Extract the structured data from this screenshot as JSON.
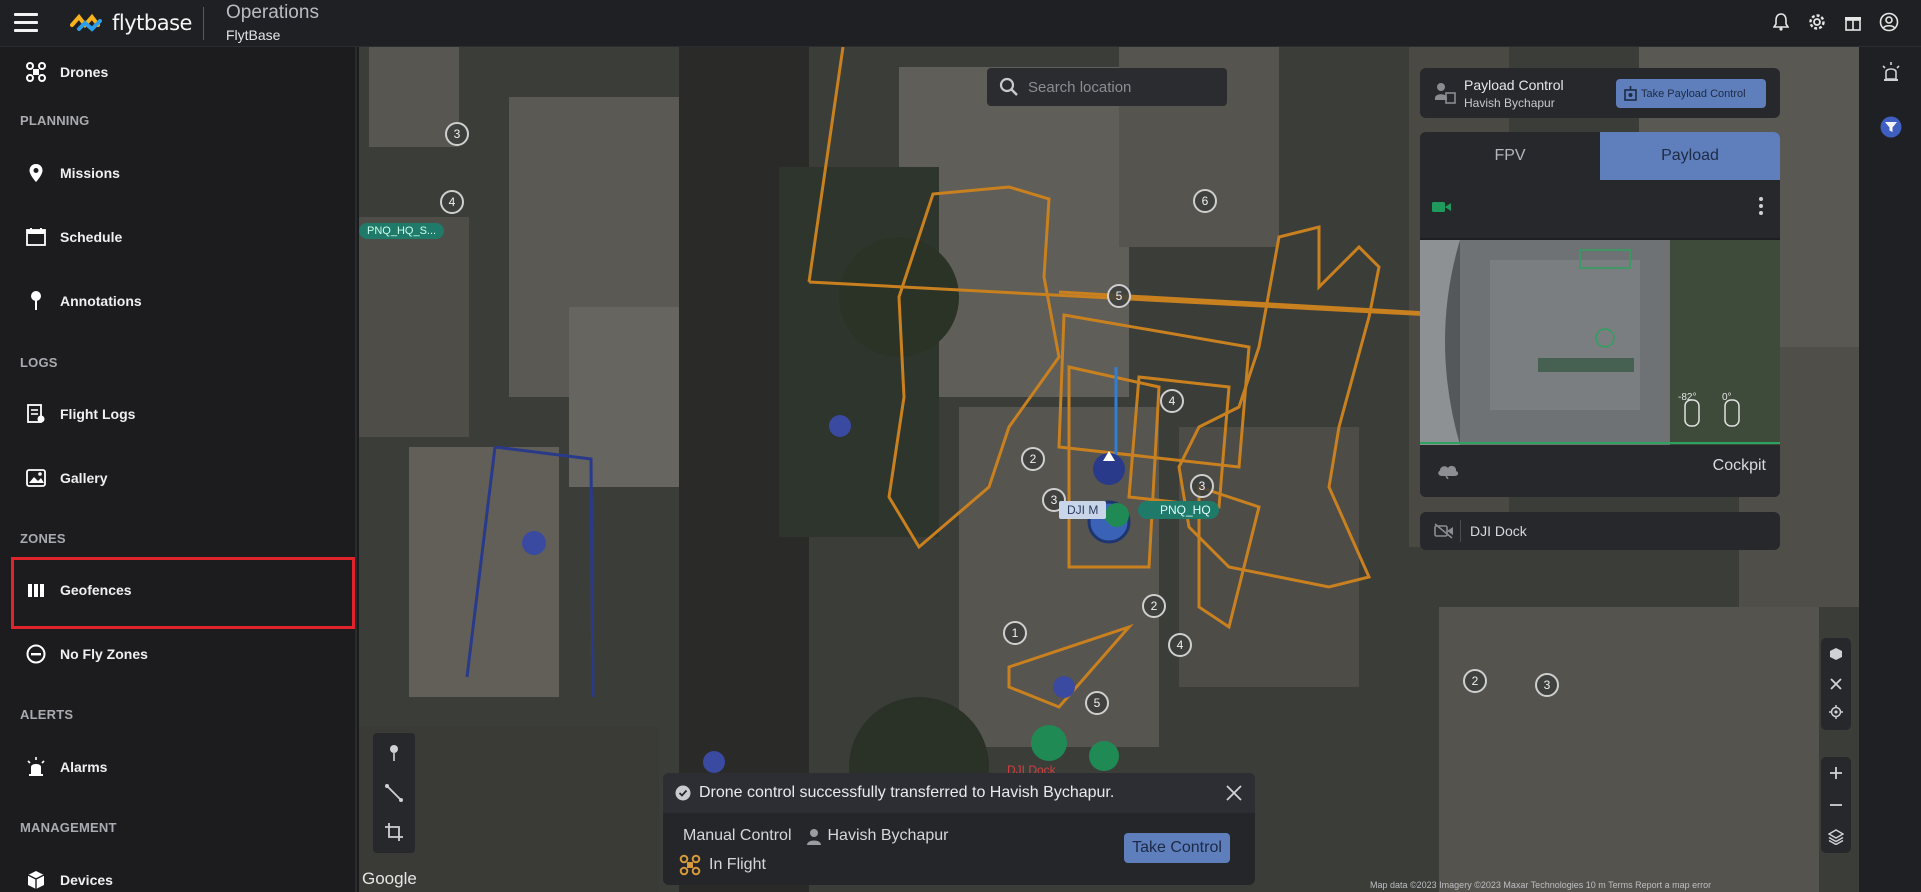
{
  "header": {
    "brand": "flytbase",
    "title": "Operations",
    "subtitle": "FlytBase"
  },
  "sidebar": {
    "items_top": [
      {
        "label": "Drones"
      }
    ],
    "sections": {
      "planning": "PLANNING",
      "logs": "LOGS",
      "zones": "ZONES",
      "alerts": "ALERTS",
      "management": "MANAGEMENT"
    },
    "planning": [
      {
        "label": "Missions"
      },
      {
        "label": "Schedule"
      },
      {
        "label": "Annotations"
      }
    ],
    "logs": [
      {
        "label": "Flight Logs"
      },
      {
        "label": "Gallery"
      }
    ],
    "zones": [
      {
        "label": "Geofences"
      },
      {
        "label": "No Fly Zones"
      }
    ],
    "alerts": [
      {
        "label": "Alarms"
      }
    ],
    "management": [
      {
        "label": "Devices"
      }
    ]
  },
  "map": {
    "search_placeholder": "Search location",
    "labels": {
      "pnq_hq_s": "PNQ_HQ_S...",
      "pnq_hq": "PNQ_HQ",
      "dji_m": "DJI M",
      "dji_dock_marker": "DJI Dock"
    },
    "waypoints": [
      "3",
      "4",
      "6",
      "5",
      "4",
      "2",
      "3",
      "3",
      "2",
      "1",
      "4",
      "5",
      "2",
      "3"
    ],
    "google": "Google",
    "attribution": "Map data ©2023 Imagery ©2023 Maxar Technologies   10 m   Terms   Report a map error"
  },
  "payload_control": {
    "title": "Payload Control",
    "user": "Havish Bychapur",
    "button": "Take Payload Control"
  },
  "video": {
    "tabs": [
      "FPV",
      "Payload"
    ],
    "active_tab": "Payload",
    "overlay_angles": [
      "-82°",
      "0°"
    ],
    "cockpit": "Cockpit"
  },
  "dock": {
    "label": "DJI Dock"
  },
  "toast": {
    "message": "Drone control successfully transferred to Havish Bychapur.",
    "mode": "Manual Control",
    "user": "Havish Bychapur",
    "status": "In Flight",
    "button": "Take Control"
  },
  "colors": {
    "accent": "#5e7fbc",
    "geofence": "#c9801f",
    "highlight": "#e0242c",
    "zone_blue": "#2a3a8a"
  }
}
